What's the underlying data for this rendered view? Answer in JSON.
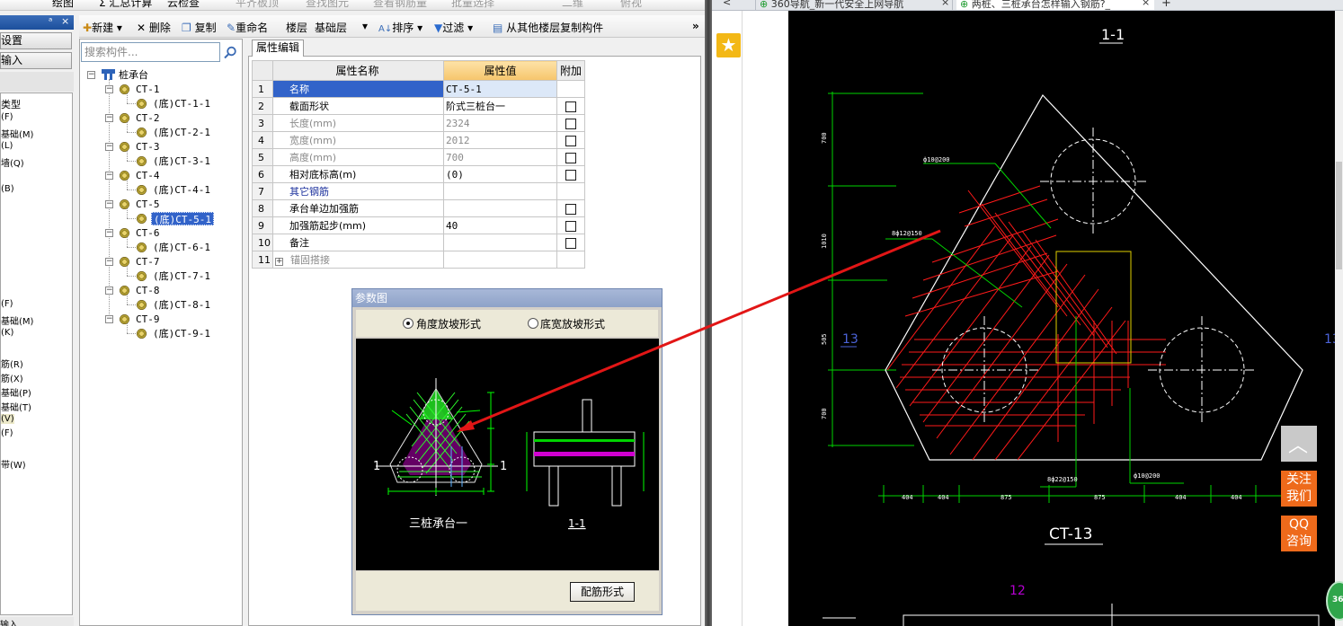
{
  "toolbar_top": {
    "items": [
      "绘图",
      "Σ 汇总计算",
      "云检查",
      "平齐板顶",
      "查找图元",
      "查看钢筋量",
      "批量选择",
      "二维",
      "俯视"
    ]
  },
  "left_panel": {
    "pin": "ᵃ",
    "close": "×",
    "btn_settings": "设置",
    "btn_input": "输入",
    "items": [
      "类型",
      "(F)",
      "基础(M)",
      "(L)",
      "墙(Q)",
      "(B)",
      "(F)",
      "基础(M)",
      "(K)",
      "筋(R)",
      "筋(X)",
      "基础(P)",
      "基础(T)",
      "(V)",
      "(F)",
      "带(W)"
    ],
    "status": "输入"
  },
  "toolbar2": {
    "new": "新建",
    "delete": "删除",
    "copy": "复制",
    "rename": "重命名",
    "floor_label": "楼层",
    "floor_value": "基础层",
    "sort": "排序",
    "filter": "过滤",
    "copy_from_floor": "从其他楼层复制构件",
    "more": "»"
  },
  "search": {
    "placeholder": "搜索构件..."
  },
  "tree": {
    "root": "桩承台",
    "nodes": [
      {
        "name": "CT-1",
        "child": "(底)CT-1-1"
      },
      {
        "name": "CT-2",
        "child": "(底)CT-2-1"
      },
      {
        "name": "CT-3",
        "child": "(底)CT-3-1"
      },
      {
        "name": "CT-4",
        "child": "(底)CT-4-1"
      },
      {
        "name": "CT-5",
        "child": "(底)CT-5-1"
      },
      {
        "name": "CT-6",
        "child": "(底)CT-6-1"
      },
      {
        "name": "CT-7",
        "child": "(底)CT-7-1"
      },
      {
        "name": "CT-8",
        "child": "(底)CT-8-1"
      },
      {
        "name": "CT-9",
        "child": "(底)CT-9-1"
      }
    ]
  },
  "prop_editor": {
    "tab": "属性编辑",
    "headers": [
      "属性名称",
      "属性值",
      "附加"
    ],
    "rows": [
      {
        "n": "1",
        "name": "名称",
        "value": "CT-5-1"
      },
      {
        "n": "2",
        "name": "截面形状",
        "value": "阶式三桩台一"
      },
      {
        "n": "3",
        "name": "长度(mm)",
        "value": "2324"
      },
      {
        "n": "4",
        "name": "宽度(mm)",
        "value": "2012"
      },
      {
        "n": "5",
        "name": "高度(mm)",
        "value": "700"
      },
      {
        "n": "6",
        "name": "相对底标高(m)",
        "value": "(0)"
      },
      {
        "n": "7",
        "name": "其它钢筋",
        "value": ""
      },
      {
        "n": "8",
        "name": "承台单边加强筋",
        "value": ""
      },
      {
        "n": "9",
        "name": "加强筋起步(mm)",
        "value": "40"
      },
      {
        "n": "10",
        "name": "备注",
        "value": ""
      },
      {
        "n": "11",
        "name": "锚固搭接",
        "value": ""
      }
    ]
  },
  "param_dialog": {
    "title": "参数图",
    "option_angle": "角度放坡形式",
    "option_width": "底宽放坡形式",
    "caption_left": "三桩承台一",
    "caption_right": "1-1",
    "marker": "1",
    "button": "配筋形式"
  },
  "browser": {
    "tab1": "360导航_新一代安全上网导航",
    "tab2": "两桩、三桩承台怎样输入钢筋?_",
    "close": "×",
    "newtab": "+",
    "back": "<",
    "fav": "★",
    "totop": "︿",
    "follow": "关注我们",
    "qq": "QQ咨询",
    "badge": "360"
  },
  "cad": {
    "section_title": "1-1",
    "label_ct": "CT-13",
    "label_13": "13",
    "label_12": "12",
    "rebar_top": "ф10@200",
    "rebar_left": "8ф12@150",
    "rebar_bottom": "8ф22@150",
    "rebar_bottom2": "ф10@200",
    "dims_bottom": [
      "404",
      "404",
      "875",
      "875",
      "404",
      "404"
    ],
    "dims_left": [
      "700",
      "1010",
      "505",
      "700"
    ]
  },
  "colors": {
    "accent_blue": "#3263c9",
    "header_orange": "#f6c56b",
    "cad_red": "#ff1a1a",
    "cad_green": "#00d400",
    "cad_yellow": "#e0d000",
    "side_orange": "#ee6a1b"
  }
}
